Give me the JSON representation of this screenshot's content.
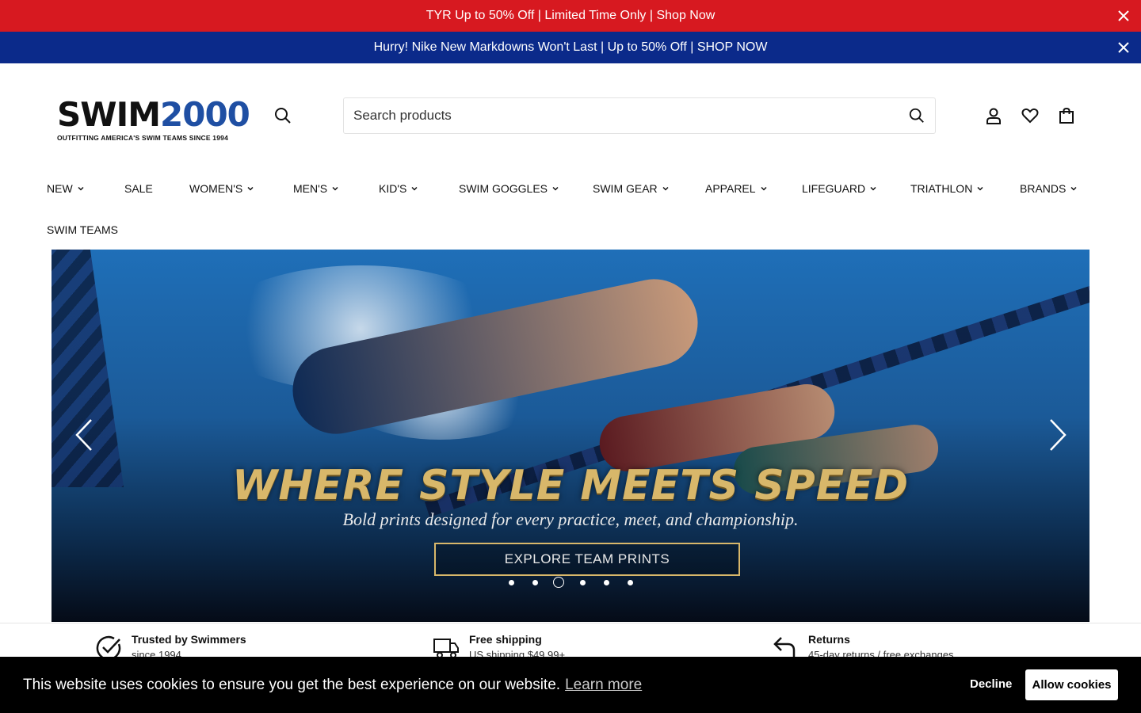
{
  "announcements": [
    {
      "text": "TYR Up to 50% Off | Limited Time Only | Shop Now",
      "color": "#d71920"
    },
    {
      "text": "Hurry! Nike New Markdowns Won't Last | Up to 50% Off | SHOP NOW",
      "color": "#0b2a8a"
    }
  ],
  "logo": {
    "word_a": "SWIM",
    "word_b": "2000",
    "tagline": "OUTFITTING AMERICA'S SWIM TEAMS SINCE 1994"
  },
  "search": {
    "placeholder": "Search products"
  },
  "nav": [
    {
      "label": "NEW",
      "dropdown": true
    },
    {
      "label": "SALE",
      "dropdown": false
    },
    {
      "label": "WOMEN'S",
      "dropdown": true
    },
    {
      "label": "MEN'S",
      "dropdown": true
    },
    {
      "label": "KID'S",
      "dropdown": true
    },
    {
      "label": "SWIM GOGGLES",
      "dropdown": true
    },
    {
      "label": "SWIM GEAR",
      "dropdown": true
    },
    {
      "label": "APPAREL",
      "dropdown": true
    },
    {
      "label": "LIFEGUARD",
      "dropdown": true
    },
    {
      "label": "TRIATHLON",
      "dropdown": true
    },
    {
      "label": "BRANDS",
      "dropdown": true
    },
    {
      "label": "SWIM TEAMS",
      "dropdown": false
    }
  ],
  "hero": {
    "title": "WHERE STYLE MEETS SPEED",
    "subtitle": "Bold prints designed for every practice, meet, and championship.",
    "cta": "EXPLORE TEAM PRINTS",
    "slide_count": 6,
    "active_slide": 3,
    "accent": "#d8b76a"
  },
  "features": [
    {
      "title": "Trusted by Swimmers",
      "sub": "since 1994",
      "icon": "check-circle-icon"
    },
    {
      "title": "Free shipping",
      "sub": "US shipping $49.99+",
      "icon": "truck-icon"
    },
    {
      "title": "Returns",
      "sub": "45-day returns / free exchanges",
      "icon": "return-arrow-icon"
    }
  ],
  "cookie": {
    "message": "This website uses cookies to ensure you get the best experience on our website.",
    "learn_more": "Learn more",
    "decline": "Decline",
    "allow": "Allow cookies"
  }
}
